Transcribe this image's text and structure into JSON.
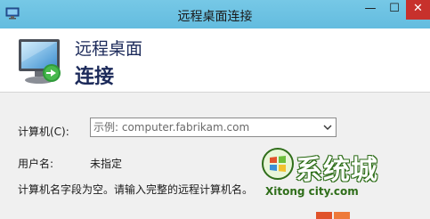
{
  "window": {
    "title": "远程桌面连接",
    "minimize_glyph": "—",
    "maximize_glyph": "☐",
    "close_glyph": "✕"
  },
  "header": {
    "line1": "远程桌面",
    "line2": "连接"
  },
  "form": {
    "computer_label": "计算机(C):",
    "computer_placeholder": "示例: computer.fabrikam.com",
    "computer_value": "",
    "username_label": "用户名:",
    "username_value": "未指定",
    "message": "计算机名字段为空。请输入完整的远程计算机名。"
  },
  "watermark": {
    "text": "系统城",
    "url": "Xitong city.com"
  },
  "colors": {
    "titlebar": "#6cc2e3",
    "close_button": "#c7312c",
    "header_text": "#1c2a5a",
    "body_bg": "#f0f0f0"
  },
  "icons": {
    "app": "remote-desktop-icon",
    "header": "monitor-icon",
    "dropdown": "chevron-down-icon"
  }
}
